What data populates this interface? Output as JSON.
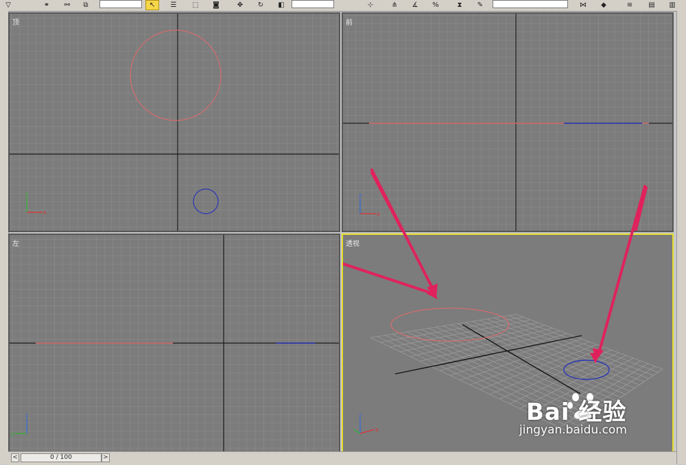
{
  "toolbar": {
    "icons": [
      "select-arrow-icon",
      "move-icon",
      "rotate-icon",
      "scale-icon",
      "snap-icon",
      "mirror-icon",
      "align-icon",
      "layer-icon"
    ]
  },
  "viewports": {
    "top": {
      "label": "顶"
    },
    "front": {
      "label": "前"
    },
    "left": {
      "label": "左"
    },
    "perspective": {
      "label": "透视"
    }
  },
  "axis_labels": {
    "x": "x",
    "y": "y",
    "z": "z"
  },
  "timeline": {
    "frame_display": "0 / 100",
    "prev": "<",
    "next": ">"
  },
  "watermark": {
    "brand": "Bai  经验",
    "url": "jingyan.baidu.com"
  },
  "colors": {
    "viewport_bg": "#7c7c7c",
    "grid": "#8e8e8e",
    "active_border": "#e5de2a",
    "circle_red": "#d66c6c",
    "circle_blue": "#2a35b8",
    "arrow": "#e0225c"
  }
}
